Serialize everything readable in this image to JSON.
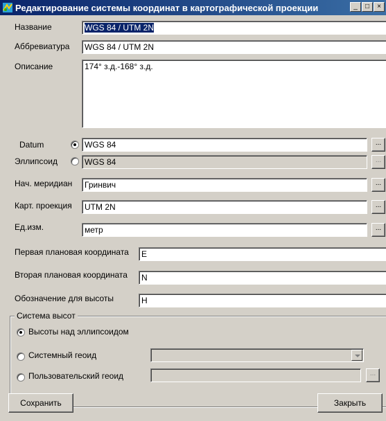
{
  "window": {
    "title": "Редактирование системы координат в картографической проекции",
    "buttons": {
      "minimize": "_",
      "maximize": "□",
      "close": "×"
    }
  },
  "fields": {
    "name": {
      "label": "Название",
      "value": "WGS 84 / UTM 2N"
    },
    "abbreviation": {
      "label": "Аббревиатура",
      "value": "WGS 84 / UTM 2N"
    },
    "description": {
      "label": "Описание",
      "value": "174° з.д.-168° з.д."
    },
    "datum": {
      "label": "Datum",
      "value": "WGS 84"
    },
    "ellipsoid": {
      "label": "Эллипсоид",
      "value": "WGS 84"
    },
    "meridian": {
      "label": "Нач. меридиан",
      "value": "Гринвич"
    },
    "projection": {
      "label": "Карт. проекция",
      "value": "UTM 2N"
    },
    "units": {
      "label": "Ед.изм.",
      "value": "метр"
    },
    "first_coord": {
      "label": "Первая плановая координата",
      "value": "E"
    },
    "second_coord": {
      "label": "Вторая плановая координата",
      "value": "N"
    },
    "height_symbol": {
      "label": "Обозначение для высоты",
      "value": "H"
    }
  },
  "browse_label": "...",
  "height_system": {
    "title": "Система высот",
    "options": [
      {
        "label": "Высоты над эллипсоидом",
        "checked": true
      },
      {
        "label": "Системный геоид",
        "checked": false
      },
      {
        "label": "Пользовательский геоид",
        "checked": false
      }
    ]
  },
  "actions": {
    "save": "Сохранить",
    "close": "Закрыть"
  }
}
